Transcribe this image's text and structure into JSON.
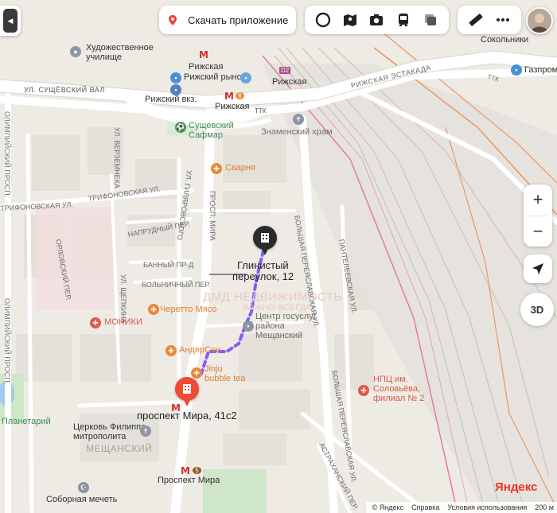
{
  "top_bar": {
    "app_button_label": "Скачать приложение",
    "tools": [
      "layers-icon",
      "panorama-icon",
      "camera-icon",
      "transport-icon",
      "traffic-icon"
    ],
    "more": [
      "ruler-icon",
      "more-icon"
    ]
  },
  "controls": {
    "zoom_in": "+",
    "zoom_out": "−",
    "three_d": "3D"
  },
  "route": {
    "destination_label": "Глинистый переулок, 12",
    "destination_line1": "Глинистый",
    "destination_line2": "переулок, 12",
    "origin_label": "проспект Мира, 41с2"
  },
  "labels": {
    "school": "Художественное",
    "school2": "училище",
    "rizhskaya_metro": "Рижская",
    "rizhsky_market": "Рижский рынок",
    "rizhskaya_d2": "Рижская",
    "rizhsky_vkz": "Рижский вкз.",
    "rizhskaya_6": "Рижская",
    "sushchevsky_val": "УЛ. СУЩЁВСКИЙ ВАЛ",
    "ttk_left": "ТТК",
    "ttk_right": "ТТК",
    "rizhskaya_estakada": "РИЖСКАЯ ЭСТАКАДА",
    "sushchevsky_1": "Сущевский",
    "sushchevsky_2": "Сафмар",
    "znamensky": "Знаменский храм",
    "svarnya": "Сварня",
    "trifonovskaya": "ТРИФОНОВСКАЯ УЛ.",
    "trifonovskaya2": "ТРИФОНОВСКАЯ УЛ.",
    "napr_per": "НАПРУДНЫЙ ПЕР.",
    "bannyi": "БАННЫЙ ПР-Д",
    "bolnichnyi": "БОЛЬНИЧНЫЙ ПЕР.",
    "cheretto": "Черетто Мясо",
    "moniki": "МОНИКИ",
    "gosuslugi1": "Центр госуслуг",
    "gosuslugi2": "района",
    "gosuslugi3": "Мещанский",
    "andersen": "АндерСон",
    "jinju1": "Jinju",
    "jinju2": "bubble tea",
    "npc1": "НПЦ им.",
    "npc2": "Соловьёва,",
    "npc3": "филиал № 2",
    "planetary": "Планетарий",
    "church1": "Церковь Филиппа",
    "church2": "митрополита",
    "meshchansky": "МЕЩАНСКИЙ",
    "prospekt_mira": "Проспект Мира",
    "sobornaya": "Соборная мечеть",
    "dmd1": "ДМД НЕДВИЖИМОСТЬ",
    "dmd2": "ВАЖНО ВСЕГДА",
    "sokolniki1": "Сокольники",
    "gazprom": "Газпром",
    "olimp": "ОЛИМПИЙСКИЙ ПРОСП.",
    "olimp2": "ОЛИМПИЙСКИЙ ПРОСП.",
    "orlovsky": "ОРЛОВСКИЙ ПЕР.",
    "shchepkina": "УЛ. ЩЕПКИНА",
    "veresaeva": "УЛ. ВЕРЗЕМНЕКА",
    "giliarovskogo": "УЛ. ГИЛЯРОВСКОГО",
    "prosp_mira": "ПРОСП. МИРА",
    "b_pereyaslavskaya": "БОЛЬШАЯ ПЕРЕЯСЛАВСКАЯ УЛ.",
    "b_pereyaslavskaya2": "БОЛЬШАЯ ПЕРЕЯСЛАВСКАЯ УЛ.",
    "pantelееvskaya": "ПАНТЕЛЕЕВСКАЯ УЛ.",
    "astrakhansky": "АСТРАХАНСКИЙ ПЕР.",
    "d2": "D2",
    "m6": "6",
    "m5": "5",
    "m_letter": "М"
  },
  "footer": {
    "copyright": "© Яндекс",
    "help": "Справка",
    "terms": "Условия использования",
    "scale": "200 м",
    "brand": "Яндекс"
  },
  "colors": {
    "route": "#8a5cf6",
    "marker_origin": "#ef4b34",
    "marker_dest": "#2b2b2b",
    "metro": "#d0322b"
  }
}
